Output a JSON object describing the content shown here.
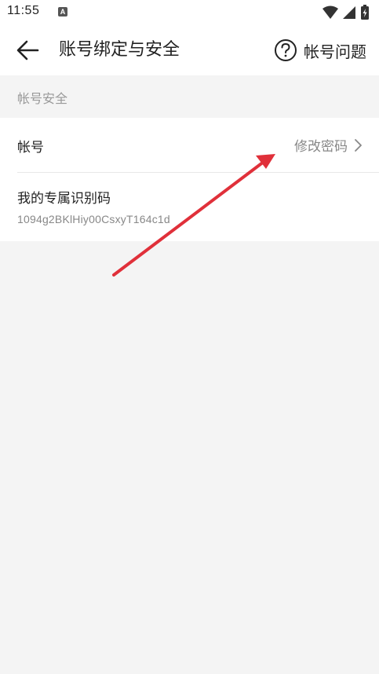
{
  "status_bar": {
    "time": "11:55",
    "app_icon_glyph": "A"
  },
  "header": {
    "title": "账号绑定与安全",
    "help_label": "帐号问题"
  },
  "section": {
    "title": "帐号安全"
  },
  "account_row": {
    "label": "帐号",
    "action_label": "修改密码"
  },
  "code_row": {
    "title": "我的专属识别码",
    "value": "1094g2BKlHiy00CsxyT164c1d"
  },
  "colors": {
    "annotation_arrow": "#e0303a",
    "background": "#f4f4f4"
  },
  "icons": {
    "back": "back-arrow-icon",
    "help": "question-circle-icon",
    "chevron": "chevron-right-icon",
    "wifi": "wifi-icon",
    "signal": "signal-icon",
    "battery": "battery-icon"
  }
}
